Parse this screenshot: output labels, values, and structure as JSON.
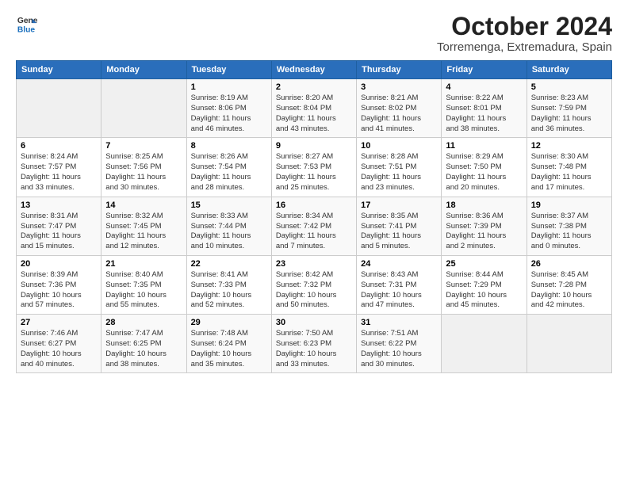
{
  "logo": {
    "line1": "General",
    "line2": "Blue"
  },
  "title": "October 2024",
  "subtitle": "Torremenga, Extremadura, Spain",
  "headers": [
    "Sunday",
    "Monday",
    "Tuesday",
    "Wednesday",
    "Thursday",
    "Friday",
    "Saturday"
  ],
  "weeks": [
    [
      {
        "day": "",
        "info": ""
      },
      {
        "day": "",
        "info": ""
      },
      {
        "day": "1",
        "info": "Sunrise: 8:19 AM\nSunset: 8:06 PM\nDaylight: 11 hours\nand 46 minutes."
      },
      {
        "day": "2",
        "info": "Sunrise: 8:20 AM\nSunset: 8:04 PM\nDaylight: 11 hours\nand 43 minutes."
      },
      {
        "day": "3",
        "info": "Sunrise: 8:21 AM\nSunset: 8:02 PM\nDaylight: 11 hours\nand 41 minutes."
      },
      {
        "day": "4",
        "info": "Sunrise: 8:22 AM\nSunset: 8:01 PM\nDaylight: 11 hours\nand 38 minutes."
      },
      {
        "day": "5",
        "info": "Sunrise: 8:23 AM\nSunset: 7:59 PM\nDaylight: 11 hours\nand 36 minutes."
      }
    ],
    [
      {
        "day": "6",
        "info": "Sunrise: 8:24 AM\nSunset: 7:57 PM\nDaylight: 11 hours\nand 33 minutes."
      },
      {
        "day": "7",
        "info": "Sunrise: 8:25 AM\nSunset: 7:56 PM\nDaylight: 11 hours\nand 30 minutes."
      },
      {
        "day": "8",
        "info": "Sunrise: 8:26 AM\nSunset: 7:54 PM\nDaylight: 11 hours\nand 28 minutes."
      },
      {
        "day": "9",
        "info": "Sunrise: 8:27 AM\nSunset: 7:53 PM\nDaylight: 11 hours\nand 25 minutes."
      },
      {
        "day": "10",
        "info": "Sunrise: 8:28 AM\nSunset: 7:51 PM\nDaylight: 11 hours\nand 23 minutes."
      },
      {
        "day": "11",
        "info": "Sunrise: 8:29 AM\nSunset: 7:50 PM\nDaylight: 11 hours\nand 20 minutes."
      },
      {
        "day": "12",
        "info": "Sunrise: 8:30 AM\nSunset: 7:48 PM\nDaylight: 11 hours\nand 17 minutes."
      }
    ],
    [
      {
        "day": "13",
        "info": "Sunrise: 8:31 AM\nSunset: 7:47 PM\nDaylight: 11 hours\nand 15 minutes."
      },
      {
        "day": "14",
        "info": "Sunrise: 8:32 AM\nSunset: 7:45 PM\nDaylight: 11 hours\nand 12 minutes."
      },
      {
        "day": "15",
        "info": "Sunrise: 8:33 AM\nSunset: 7:44 PM\nDaylight: 11 hours\nand 10 minutes."
      },
      {
        "day": "16",
        "info": "Sunrise: 8:34 AM\nSunset: 7:42 PM\nDaylight: 11 hours\nand 7 minutes."
      },
      {
        "day": "17",
        "info": "Sunrise: 8:35 AM\nSunset: 7:41 PM\nDaylight: 11 hours\nand 5 minutes."
      },
      {
        "day": "18",
        "info": "Sunrise: 8:36 AM\nSunset: 7:39 PM\nDaylight: 11 hours\nand 2 minutes."
      },
      {
        "day": "19",
        "info": "Sunrise: 8:37 AM\nSunset: 7:38 PM\nDaylight: 11 hours\nand 0 minutes."
      }
    ],
    [
      {
        "day": "20",
        "info": "Sunrise: 8:39 AM\nSunset: 7:36 PM\nDaylight: 10 hours\nand 57 minutes."
      },
      {
        "day": "21",
        "info": "Sunrise: 8:40 AM\nSunset: 7:35 PM\nDaylight: 10 hours\nand 55 minutes."
      },
      {
        "day": "22",
        "info": "Sunrise: 8:41 AM\nSunset: 7:33 PM\nDaylight: 10 hours\nand 52 minutes."
      },
      {
        "day": "23",
        "info": "Sunrise: 8:42 AM\nSunset: 7:32 PM\nDaylight: 10 hours\nand 50 minutes."
      },
      {
        "day": "24",
        "info": "Sunrise: 8:43 AM\nSunset: 7:31 PM\nDaylight: 10 hours\nand 47 minutes."
      },
      {
        "day": "25",
        "info": "Sunrise: 8:44 AM\nSunset: 7:29 PM\nDaylight: 10 hours\nand 45 minutes."
      },
      {
        "day": "26",
        "info": "Sunrise: 8:45 AM\nSunset: 7:28 PM\nDaylight: 10 hours\nand 42 minutes."
      }
    ],
    [
      {
        "day": "27",
        "info": "Sunrise: 7:46 AM\nSunset: 6:27 PM\nDaylight: 10 hours\nand 40 minutes."
      },
      {
        "day": "28",
        "info": "Sunrise: 7:47 AM\nSunset: 6:25 PM\nDaylight: 10 hours\nand 38 minutes."
      },
      {
        "day": "29",
        "info": "Sunrise: 7:48 AM\nSunset: 6:24 PM\nDaylight: 10 hours\nand 35 minutes."
      },
      {
        "day": "30",
        "info": "Sunrise: 7:50 AM\nSunset: 6:23 PM\nDaylight: 10 hours\nand 33 minutes."
      },
      {
        "day": "31",
        "info": "Sunrise: 7:51 AM\nSunset: 6:22 PM\nDaylight: 10 hours\nand 30 minutes."
      },
      {
        "day": "",
        "info": ""
      },
      {
        "day": "",
        "info": ""
      }
    ]
  ]
}
